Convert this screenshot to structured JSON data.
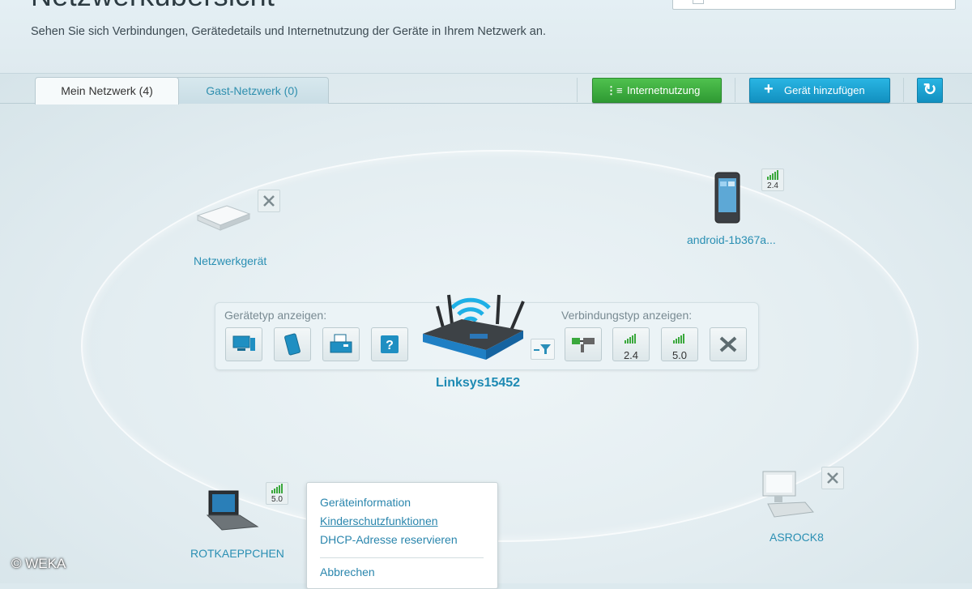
{
  "header": {
    "title": "Netzwerkübersicht",
    "subtitle": "Sehen Sie sich Verbindungen, Gerätedetails und Internetnutzung der Geräte in Ihrem Netzwerk an."
  },
  "tabs": [
    {
      "label": "Mein Netzwerk (4)",
      "active": true
    },
    {
      "label": "Gast-Netzwerk (0)",
      "active": false
    }
  ],
  "toolbar": {
    "usage_label": "Internetnutzung",
    "add_device_label": "Gerät hinzufügen"
  },
  "devices": {
    "network_device": {
      "label": "Netzwerkgerät"
    },
    "android": {
      "label": "android-1b367a...",
      "band": "2.4"
    },
    "laptop": {
      "label": "ROTKAEPPCHEN",
      "band": "5.0"
    },
    "desktop": {
      "label": "ASROCK8"
    }
  },
  "router": {
    "name": "Linksys15452"
  },
  "filters": {
    "device_type_label": "Gerätetyp anzeigen:",
    "connection_type_label": "Verbindungstyp anzeigen:",
    "band_24": "2.4",
    "band_50": "5.0"
  },
  "context_menu": {
    "items": [
      "Geräteinformation",
      "Kinderschutzfunktionen",
      "DHCP-Adresse reservieren"
    ],
    "cancel": "Abbrechen"
  },
  "watermark": "© WEKA",
  "colors": {
    "accent_blue": "#1d8ab3",
    "green_button": "#3aa83c",
    "blue_button": "#1ea3d3"
  }
}
